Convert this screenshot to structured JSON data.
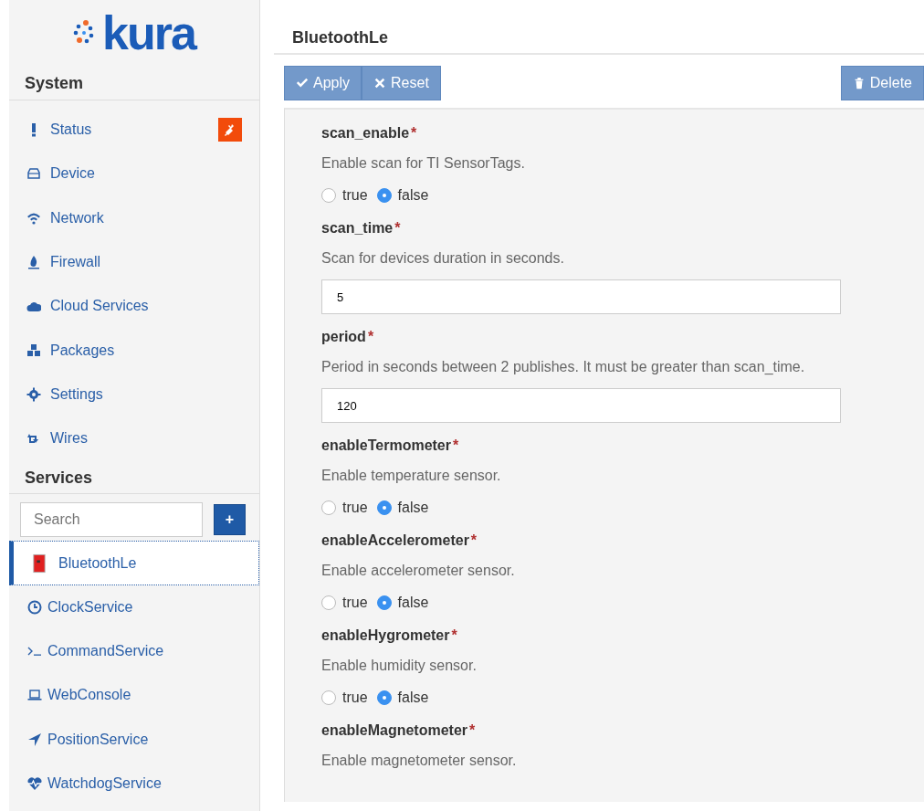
{
  "sidebar": {
    "logo_text": "kura",
    "system_heading": "System",
    "system_items": [
      {
        "label": "Status",
        "alert": true
      },
      {
        "label": "Device",
        "alert": false
      },
      {
        "label": "Network",
        "alert": false
      },
      {
        "label": "Firewall",
        "alert": false
      },
      {
        "label": "Cloud Services",
        "alert": false
      },
      {
        "label": "Packages",
        "alert": false
      },
      {
        "label": "Settings",
        "alert": false
      },
      {
        "label": "Wires",
        "alert": false
      }
    ],
    "services_heading": "Services",
    "search": {
      "placeholder": "Search"
    },
    "add_button": "+",
    "services": [
      {
        "label": "BluetoothLe",
        "selected": true
      },
      {
        "label": "ClockService",
        "selected": false
      },
      {
        "label": "CommandService",
        "selected": false
      },
      {
        "label": "WebConsole",
        "selected": false
      },
      {
        "label": "PositionService",
        "selected": false
      },
      {
        "label": "WatchdogService",
        "selected": false
      }
    ]
  },
  "main": {
    "title": "BluetoothLe",
    "buttons": [
      {
        "label": "Apply"
      },
      {
        "label": "Reset"
      }
    ],
    "delete_button": "Delete",
    "fields": [
      {
        "kind": "radio",
        "label": "scan_enable",
        "required_mark": "*",
        "description": "Enable scan for TI SensorTags.",
        "options": [
          {
            "label": "true",
            "selected": false
          },
          {
            "label": "false",
            "selected": true
          }
        ]
      },
      {
        "kind": "text",
        "label": "scan_time",
        "required_mark": "*",
        "description": "Scan for devices duration in seconds.",
        "value": "5"
      },
      {
        "kind": "text",
        "label": "period",
        "required_mark": "*",
        "description": "Period in seconds between 2 publishes. It must be greater than scan_time.",
        "value": "120"
      },
      {
        "kind": "radio",
        "label": "enableTermometer",
        "required_mark": "*",
        "description": "Enable temperature sensor.",
        "options": [
          {
            "label": "true",
            "selected": false
          },
          {
            "label": "false",
            "selected": true
          }
        ]
      },
      {
        "kind": "radio",
        "label": "enableAccelerometer",
        "required_mark": "*",
        "description": "Enable accelerometer sensor.",
        "options": [
          {
            "label": "true",
            "selected": false
          },
          {
            "label": "false",
            "selected": true
          }
        ]
      },
      {
        "kind": "radio",
        "label": "enableHygrometer",
        "required_mark": "*",
        "description": "Enable humidity sensor.",
        "options": [
          {
            "label": "true",
            "selected": false
          },
          {
            "label": "false",
            "selected": true
          }
        ]
      },
      {
        "kind": "note",
        "label": "enableMagnetometer",
        "required_mark": "*",
        "description": "Enable magnetometer sensor."
      }
    ]
  }
}
